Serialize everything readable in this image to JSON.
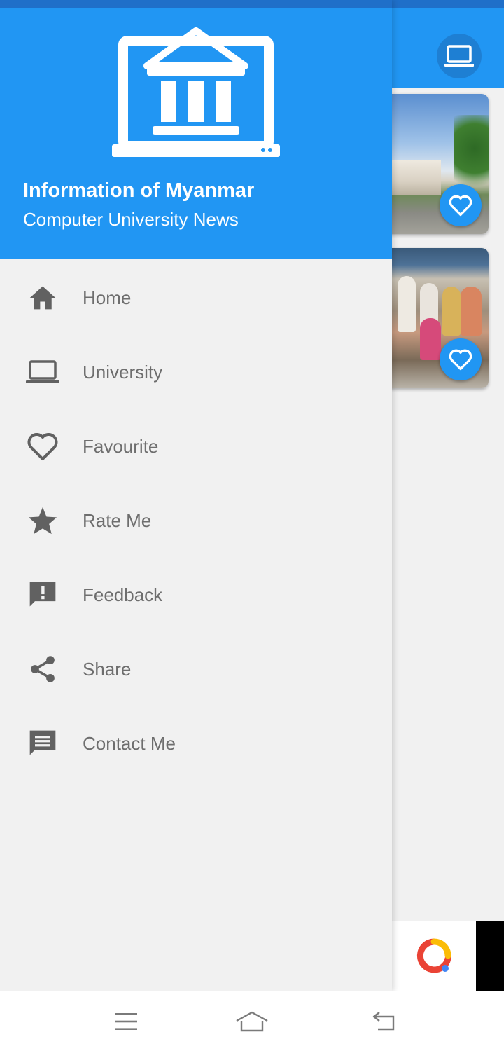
{
  "drawer": {
    "title": "Information of Myanmar",
    "subtitle": "Computer University News",
    "logo": "university-laptop-logo"
  },
  "menu": {
    "items": [
      {
        "label": "Home",
        "icon": "home-icon"
      },
      {
        "label": "University",
        "icon": "laptop-icon"
      },
      {
        "label": "Favourite",
        "icon": "heart-outline-icon"
      },
      {
        "label": "Rate Me",
        "icon": "star-icon"
      },
      {
        "label": "Feedback",
        "icon": "feedback-icon"
      },
      {
        "label": "Share",
        "icon": "share-icon"
      },
      {
        "label": "Contact Me",
        "icon": "message-icon"
      }
    ]
  },
  "colors": {
    "primary": "#2196f3",
    "status_bar": "#1f6fc9",
    "drawer_bg": "#f1f1f1",
    "menu_text": "#6e6e6e",
    "menu_icon": "#616161"
  },
  "appbar": {
    "action_icon": "laptop-icon"
  },
  "cards": [
    {
      "favourite_icon": "heart-outline-icon"
    },
    {
      "favourite_icon": "heart-outline-icon"
    }
  ],
  "system_nav": {
    "buttons": [
      "menu-icon",
      "home-icon",
      "back-icon"
    ]
  }
}
